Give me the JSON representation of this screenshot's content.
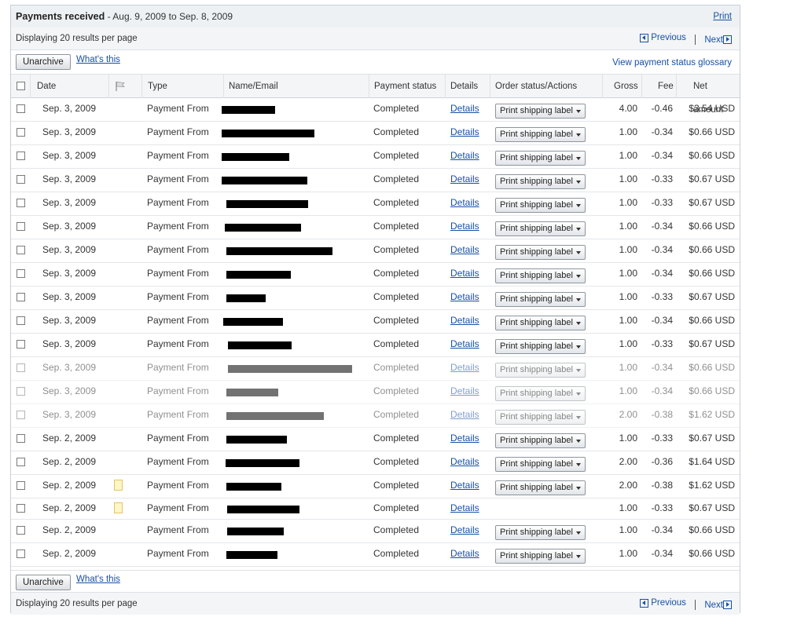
{
  "header": {
    "title": "Payments received",
    "range": " - Aug. 9, 2009 to Sep. 8, 2009",
    "print": "Print"
  },
  "pager": {
    "info": "Displaying 20 results per page",
    "previous": "Previous",
    "next": "Next"
  },
  "actions": {
    "unarchive": "Unarchive",
    "whats_this": "What's this",
    "glossary": "View payment status glossary"
  },
  "columns": {
    "date": "Date",
    "type": "Type",
    "name_email": "Name/Email",
    "payment_status": "Payment status",
    "details": "Details",
    "order_status": "Order status/Actions",
    "gross": "Gross",
    "fee": "Fee",
    "net": "Net amount"
  },
  "rows": [
    {
      "date": "Sep. 3, 2009",
      "type": "Payment From",
      "status": "Completed",
      "details": "Details",
      "action": "Print shipping label",
      "gross": "4.00",
      "fee": "-0.46",
      "net": "$3.54 USD"
    },
    {
      "date": "Sep. 3, 2009",
      "type": "Payment From",
      "status": "Completed",
      "details": "Details",
      "action": "Print shipping label",
      "gross": "1.00",
      "fee": "-0.34",
      "net": "$0.66 USD"
    },
    {
      "date": "Sep. 3, 2009",
      "type": "Payment From",
      "status": "Completed",
      "details": "Details",
      "action": "Print shipping label",
      "gross": "1.00",
      "fee": "-0.34",
      "net": "$0.66 USD"
    },
    {
      "date": "Sep. 3, 2009",
      "type": "Payment From",
      "status": "Completed",
      "details": "Details",
      "action": "Print shipping label",
      "gross": "1.00",
      "fee": "-0.33",
      "net": "$0.67 USD"
    },
    {
      "date": "Sep. 3, 2009",
      "type": "Payment From",
      "status": "Completed",
      "details": "Details",
      "action": "Print shipping label",
      "gross": "1.00",
      "fee": "-0.33",
      "net": "$0.67 USD"
    },
    {
      "date": "Sep. 3, 2009",
      "type": "Payment From",
      "status": "Completed",
      "details": "Details",
      "action": "Print shipping label",
      "gross": "1.00",
      "fee": "-0.34",
      "net": "$0.66 USD"
    },
    {
      "date": "Sep. 3, 2009",
      "type": "Payment From",
      "status": "Completed",
      "details": "Details",
      "action": "Print shipping label",
      "gross": "1.00",
      "fee": "-0.34",
      "net": "$0.66 USD"
    },
    {
      "date": "Sep. 3, 2009",
      "type": "Payment From",
      "status": "Completed",
      "details": "Details",
      "action": "Print shipping label",
      "gross": "1.00",
      "fee": "-0.34",
      "net": "$0.66 USD"
    },
    {
      "date": "Sep. 3, 2009",
      "type": "Payment From",
      "status": "Completed",
      "details": "Details",
      "action": "Print shipping label",
      "gross": "1.00",
      "fee": "-0.33",
      "net": "$0.67 USD"
    },
    {
      "date": "Sep. 3, 2009",
      "type": "Payment From",
      "status": "Completed",
      "details": "Details",
      "action": "Print shipping label",
      "gross": "1.00",
      "fee": "-0.34",
      "net": "$0.66 USD"
    },
    {
      "date": "Sep. 3, 2009",
      "type": "Payment From",
      "status": "Completed",
      "details": "Details",
      "action": "Print shipping label",
      "gross": "1.00",
      "fee": "-0.33",
      "net": "$0.67 USD"
    },
    {
      "date": "Sep. 3, 2009",
      "type": "Payment From",
      "status": "Completed",
      "details": "Details",
      "action": "Print shipping label",
      "gross": "1.00",
      "fee": "-0.34",
      "net": "$0.66 USD"
    },
    {
      "date": "Sep. 3, 2009",
      "type": "Payment From",
      "status": "Completed",
      "details": "Details",
      "action": "Print shipping label",
      "gross": "1.00",
      "fee": "-0.34",
      "net": "$0.66 USD"
    },
    {
      "date": "Sep. 3, 2009",
      "type": "Payment From",
      "status": "Completed",
      "details": "Details",
      "action": "Print shipping label",
      "gross": "2.00",
      "fee": "-0.38",
      "net": "$1.62 USD"
    },
    {
      "date": "Sep. 2, 2009",
      "type": "Payment From",
      "status": "Completed",
      "details": "Details",
      "action": "Print shipping label",
      "gross": "1.00",
      "fee": "-0.33",
      "net": "$0.67 USD"
    },
    {
      "date": "Sep. 2, 2009",
      "type": "Payment From",
      "status": "Completed",
      "details": "Details",
      "action": "Print shipping label",
      "gross": "2.00",
      "fee": "-0.36",
      "net": "$1.64 USD"
    },
    {
      "date": "Sep. 2, 2009",
      "type": "Payment From",
      "status": "Completed",
      "details": "Details",
      "action": "Print shipping label",
      "gross": "2.00",
      "fee": "-0.38",
      "net": "$1.62 USD"
    },
    {
      "date": "Sep. 2, 2009",
      "type": "Payment From",
      "status": "Completed",
      "details": "Details",
      "action": "",
      "gross": "1.00",
      "fee": "-0.33",
      "net": "$0.67 USD"
    },
    {
      "date": "Sep. 2, 2009",
      "type": "Payment From",
      "status": "Completed",
      "details": "Details",
      "action": "Print shipping label",
      "gross": "1.00",
      "fee": "-0.34",
      "net": "$0.66 USD"
    },
    {
      "date": "Sep. 2, 2009",
      "type": "Payment From",
      "status": "Completed",
      "details": "Details",
      "action": "Print shipping label",
      "gross": "1.00",
      "fee": "-0.34",
      "net": "$0.66 USD"
    }
  ]
}
